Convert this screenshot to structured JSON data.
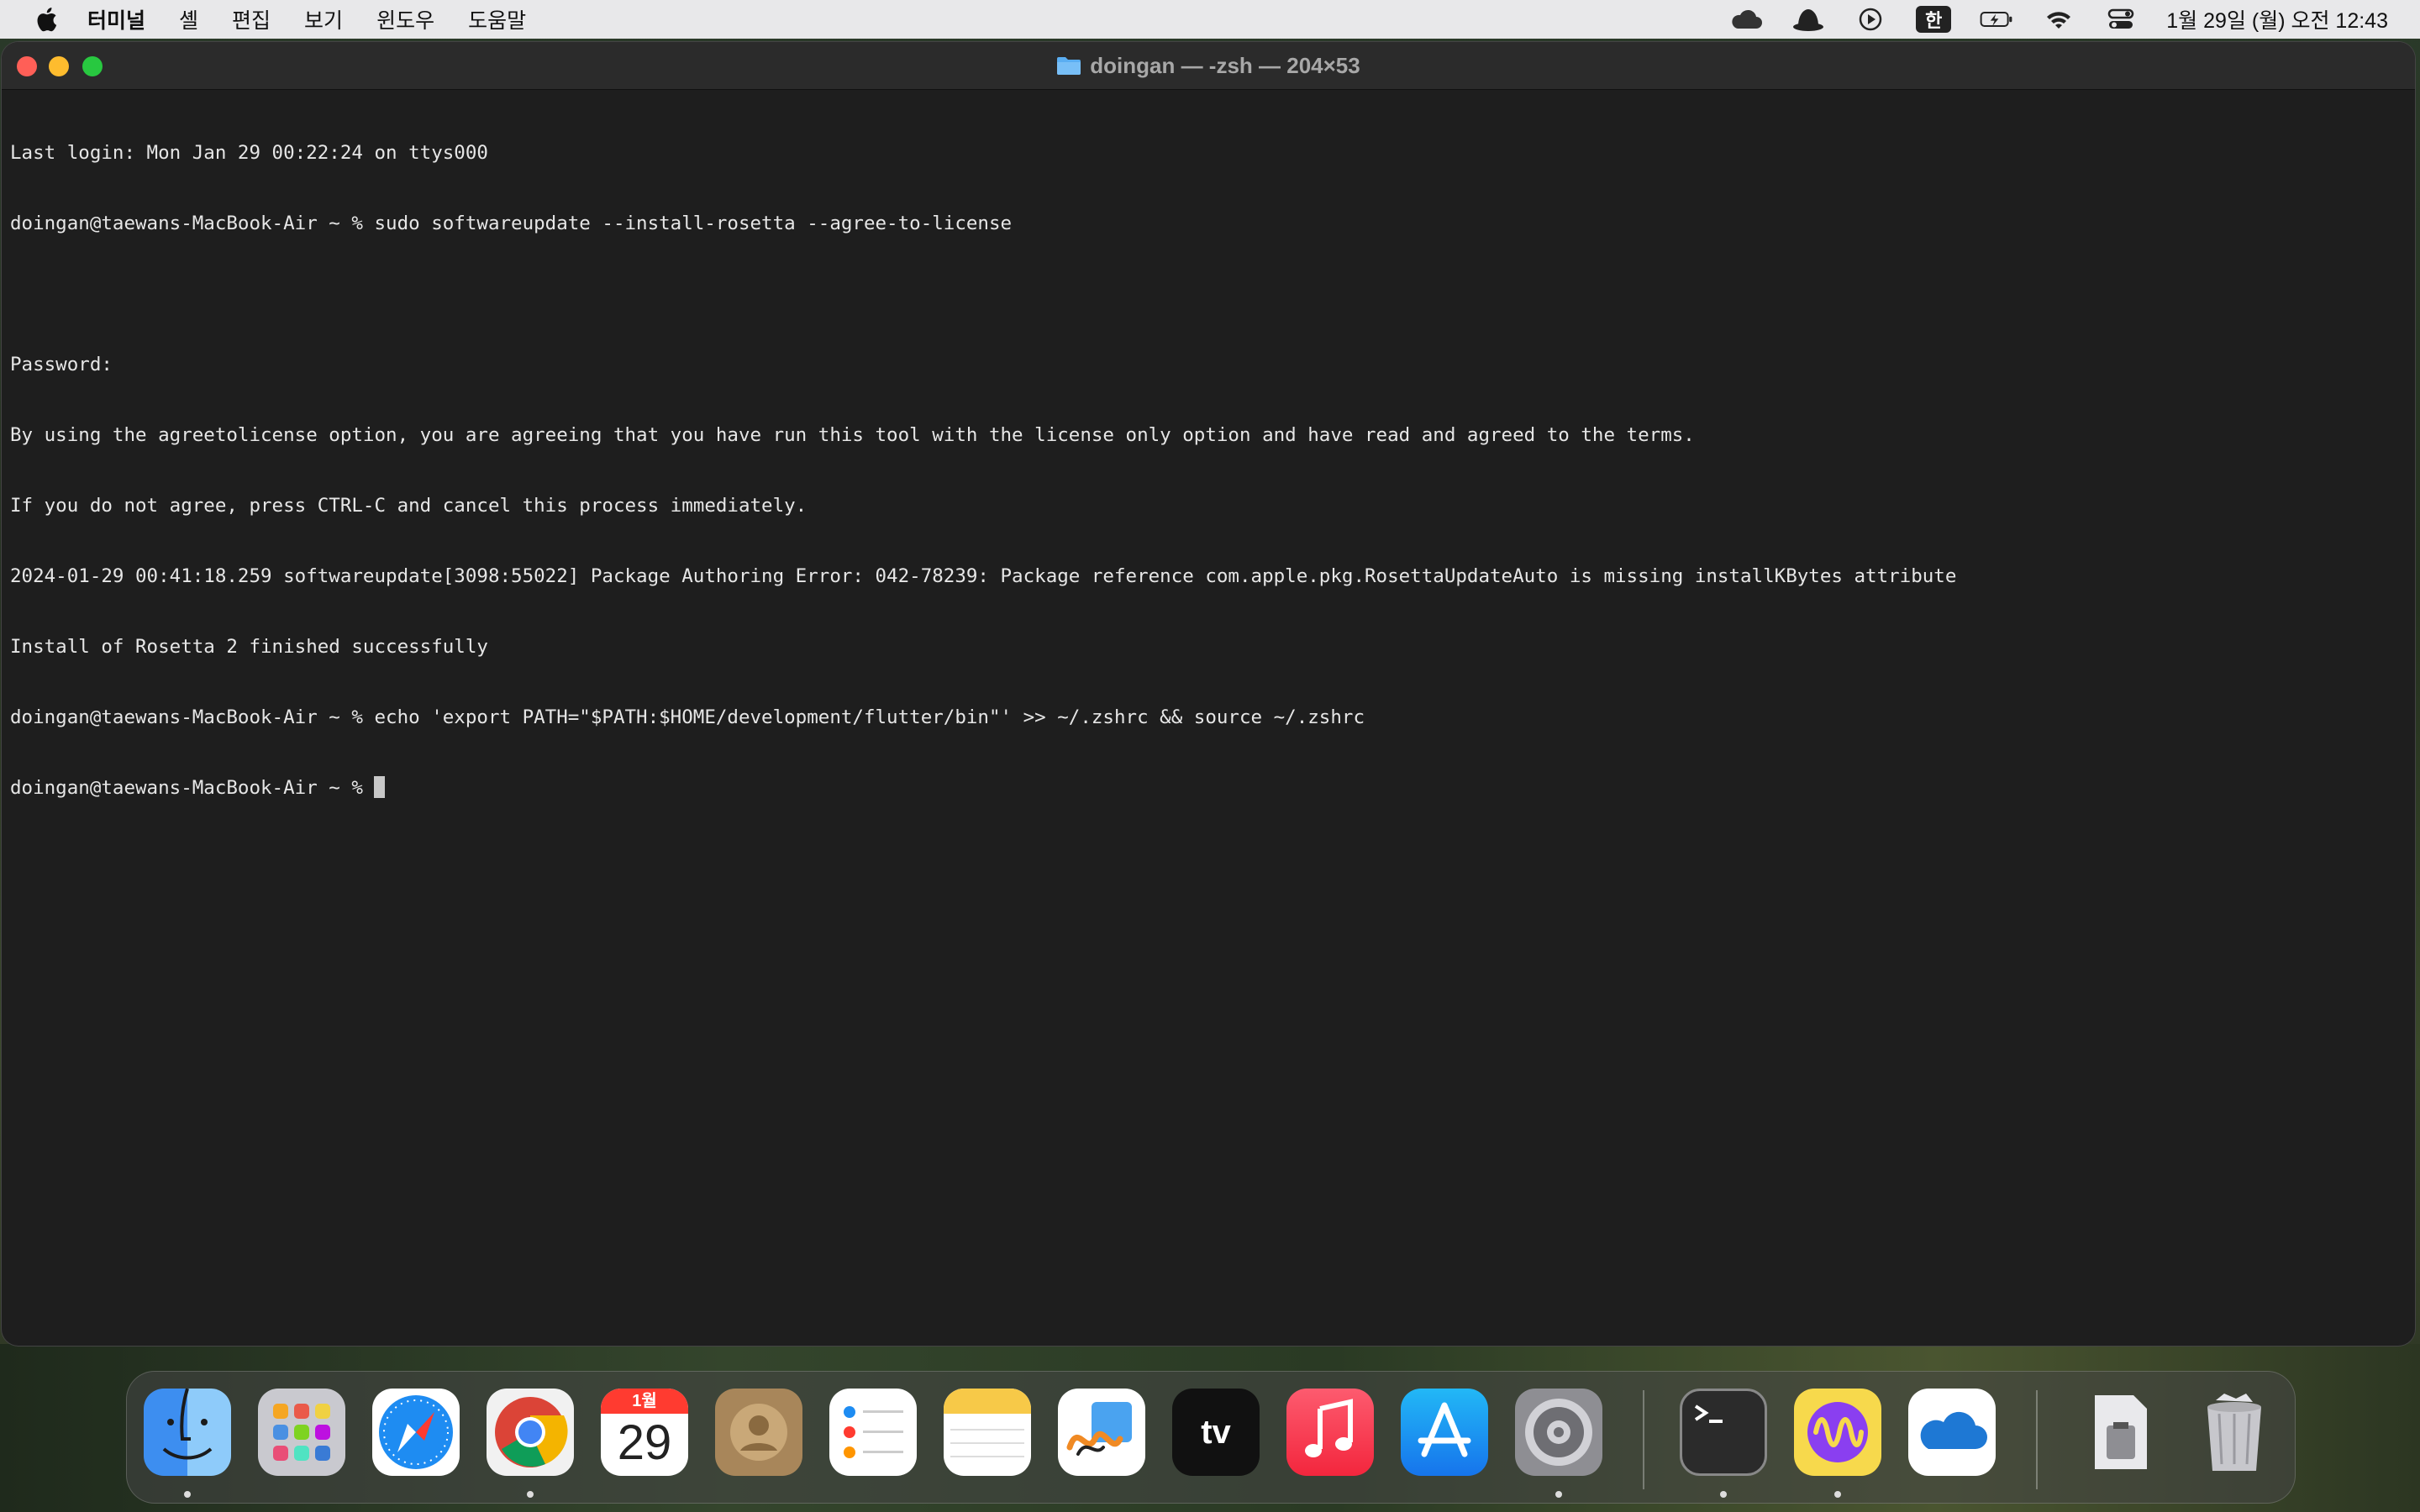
{
  "menubar": {
    "items": [
      "터미널",
      "셸",
      "편집",
      "보기",
      "윈도우",
      "도움말"
    ],
    "input_method": "한",
    "clock": "1월 29일 (월) 오전 12:43"
  },
  "window": {
    "title": "doingan — -zsh — 204×53"
  },
  "terminal": {
    "lines": [
      "Last login: Mon Jan 29 00:22:24 on ttys000",
      "doingan@taewans-MacBook-Air ~ % sudo softwareupdate --install-rosetta --agree-to-license",
      "",
      "Password:",
      "By using the agreetolicense option, you are agreeing that you have run this tool with the license only option and have read and agreed to the terms.",
      "If you do not agree, press CTRL-C and cancel this process immediately.",
      "2024-01-29 00:41:18.259 softwareupdate[3098:55022] Package Authoring Error: 042-78239: Package reference com.apple.pkg.RosettaUpdateAuto is missing installKBytes attribute",
      "Install of Rosetta 2 finished successfully",
      "doingan@taewans-MacBook-Air ~ % echo 'export PATH=\"$PATH:$HOME/development/flutter/bin\"' >> ~/.zshrc && source ~/.zshrc",
      "doingan@taewans-MacBook-Air ~ % "
    ]
  },
  "dock": {
    "apps": [
      "finder-icon",
      "launchpad-icon",
      "safari-icon",
      "chrome-icon",
      "calendar-icon",
      "contacts-icon",
      "reminders-icon",
      "notes-icon",
      "freeform-icon",
      "appletv-icon",
      "music-icon",
      "appstore-icon",
      "settings-icon",
      "terminal-icon",
      "podcast-wave-icon",
      "onedrive-icon",
      "archive-icon",
      "trash-icon"
    ],
    "calendar_month": "1월",
    "calendar_day": "29",
    "tv_label": "tv"
  }
}
